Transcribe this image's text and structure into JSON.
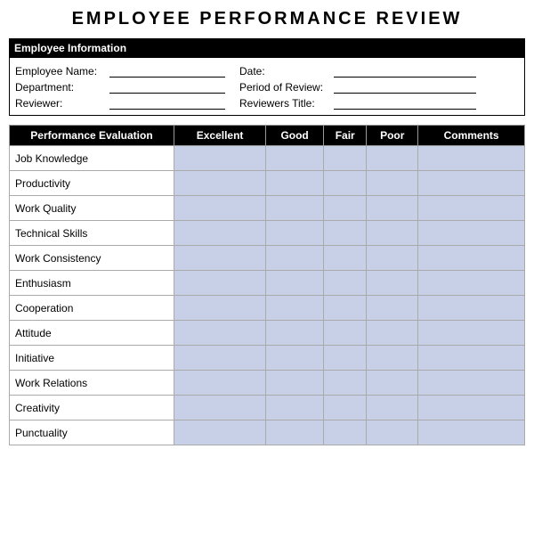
{
  "title": "EMPLOYEE  PERFORMANCE  REVIEW",
  "employeeInfo": {
    "header": "Employee Information",
    "fields": [
      {
        "label": "Employee Name:",
        "inputWidth": 130
      },
      {
        "label": "Date:",
        "inputWidth": 140
      }
    ],
    "fields2": [
      {
        "label": "Department:",
        "inputWidth": 130
      },
      {
        "label": "Period of Review:",
        "inputWidth": 140
      }
    ],
    "fields3": [
      {
        "label": "Reviewer:",
        "inputWidth": 130
      },
      {
        "label": "Reviewers Title:",
        "inputWidth": 140
      }
    ]
  },
  "table": {
    "headers": [
      "Performance Evaluation",
      "Excellent",
      "Good",
      "Fair",
      "Poor",
      "Comments"
    ],
    "rows": [
      "Job Knowledge",
      "Productivity",
      "Work Quality",
      "Technical Skills",
      "Work Consistency",
      "Enthusiasm",
      "Cooperation",
      "Attitude",
      "Initiative",
      "Work Relations",
      "Creativity",
      "Punctuality"
    ]
  }
}
